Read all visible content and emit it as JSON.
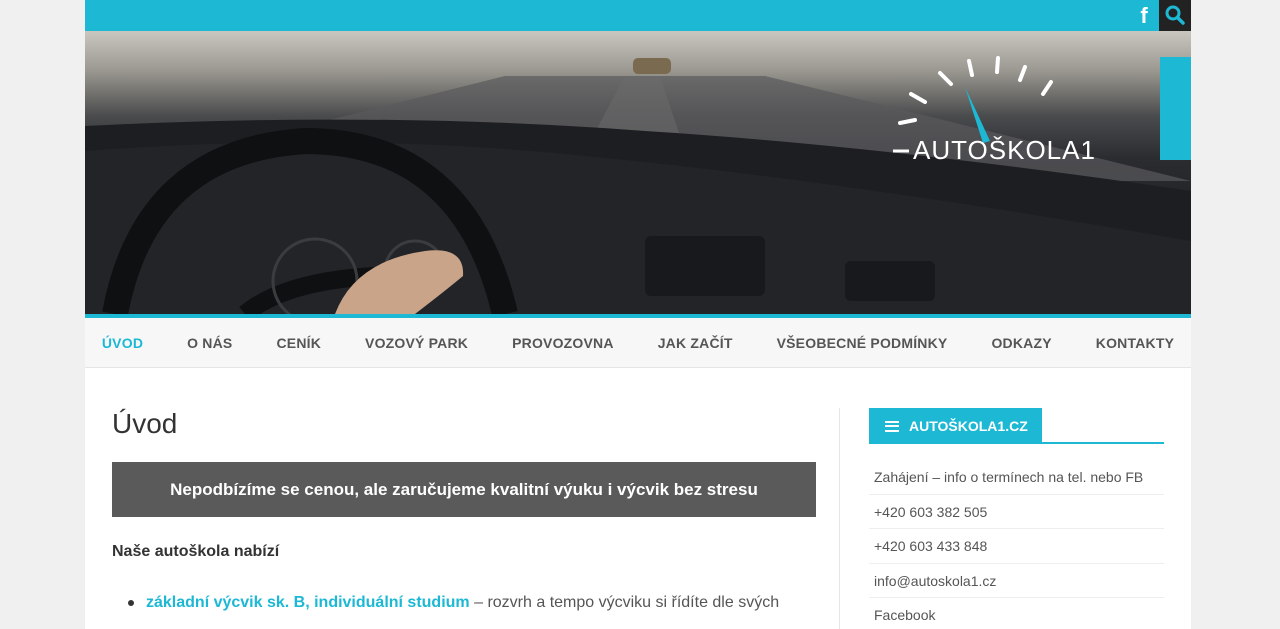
{
  "header": {
    "logo_text": "AUTOŠKOLA1",
    "facebook_icon": "facebook-icon",
    "search_icon": "search-icon"
  },
  "nav": {
    "items": [
      "ÚVOD",
      "O NÁS",
      "CENÍK",
      "VOZOVÝ PARK",
      "PROVOZOVNA",
      "JAK ZAČÍT",
      "VŠEOBECNÉ PODMÍNKY",
      "ODKAZY",
      "KONTAKTY"
    ],
    "active": "ÚVOD"
  },
  "main": {
    "title": "Úvod",
    "banner": "Nepodbízíme se cenou, ale zaručujeme kvalitní výuku i výcvik bez stresu",
    "offers_heading": "Naše autoškola nabízí",
    "list": [
      {
        "link": "základní výcvik sk. B, individuální studium",
        "text": " – rozvrh a tempo výcviku si řídíte dle svých"
      }
    ]
  },
  "sidebar": {
    "title": "AUTOŠKOLA1.CZ",
    "menu_icon": "menu-icon",
    "items": [
      "Zahájení – info o termínech na tel. nebo FB",
      "+420 603 382 505",
      "+420 603 433 848",
      "info@autoskola1.cz",
      "Facebook"
    ]
  },
  "colors": {
    "accent": "#1cb8d4",
    "banner_bg": "#5a5a5a",
    "text": "#333333"
  }
}
